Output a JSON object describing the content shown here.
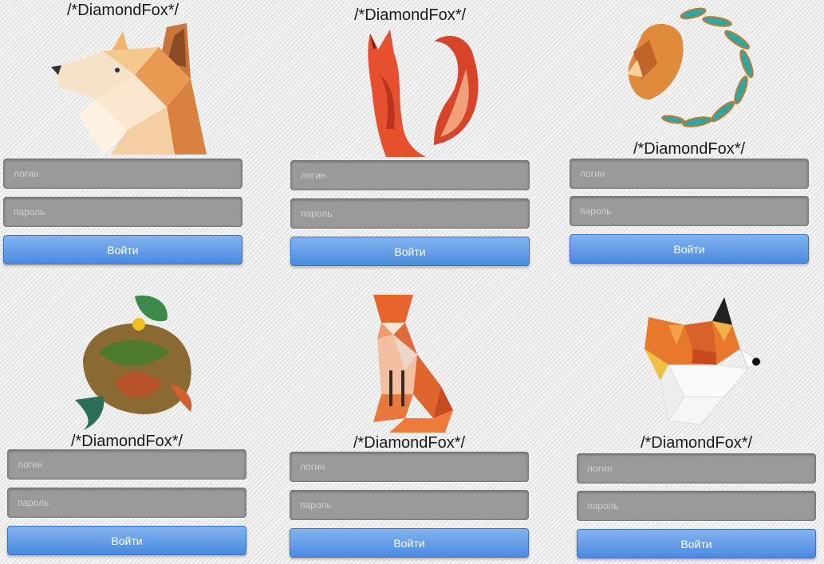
{
  "panels": [
    {
      "title": "/*DiamondFox*/",
      "login_placeholder": "логин",
      "password_placeholder": "пароль",
      "submit_label": "Войти"
    },
    {
      "title": "/*DiamondFox*/",
      "login_placeholder": "логин",
      "password_placeholder": "пароль",
      "submit_label": "Войти"
    },
    {
      "title": "/*DiamondFox*/",
      "login_placeholder": "логин",
      "password_placeholder": "пароль",
      "submit_label": "Войти"
    },
    {
      "title": "/*DiamondFox*/",
      "login_placeholder": "логин",
      "password_placeholder": "пароль",
      "submit_label": "Войти"
    },
    {
      "title": "/*DiamondFox*/",
      "login_placeholder": "логин",
      "password_placeholder": "пароль",
      "submit_label": "Войти"
    },
    {
      "title": "/*DiamondFox*/",
      "login_placeholder": "логин",
      "password_placeholder": "пароль",
      "submit_label": "Войти"
    }
  ],
  "icons": [
    "fox-head-lowpoly-icon",
    "fox-sitting-watercolor-icon",
    "fox-feather-tail-icon",
    "fox-watercolor-abstract-icon",
    "fox-sitting-lowpoly-icon",
    "fox-head-geometric-icon"
  ]
}
